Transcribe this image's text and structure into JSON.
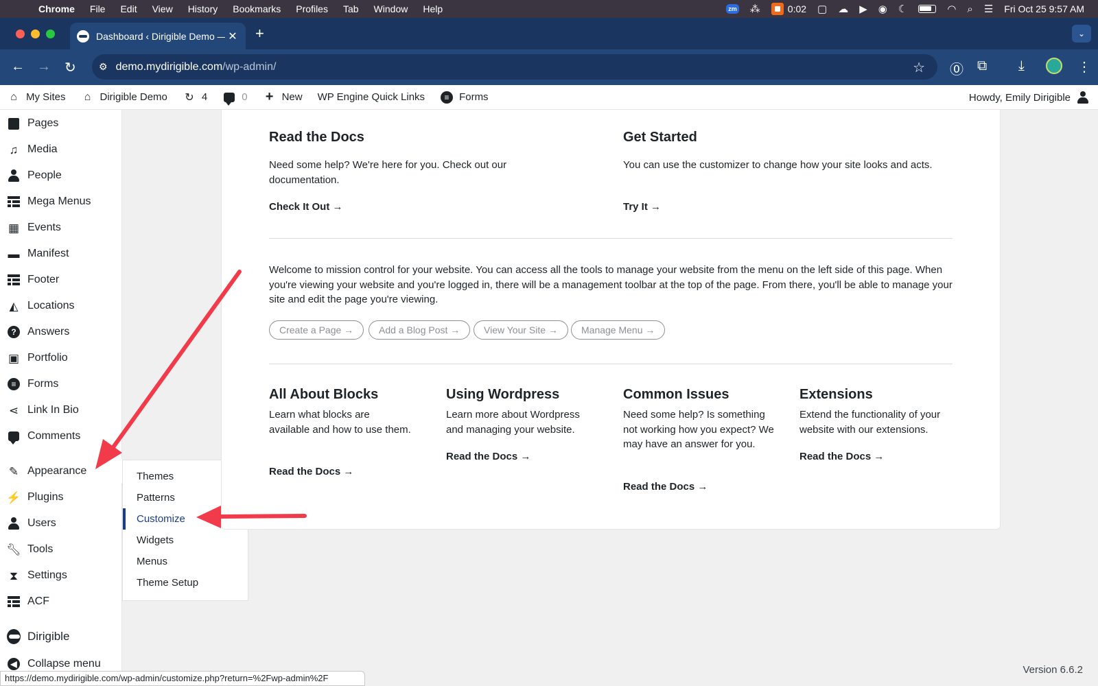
{
  "macos": {
    "app_name": "Chrome",
    "menus": [
      "File",
      "Edit",
      "View",
      "History",
      "Bookmarks",
      "Profiles",
      "Tab",
      "Window",
      "Help"
    ],
    "zoom_badge": "zm",
    "recording_time": "0:02",
    "clock": "Fri Oct 25  9:57 AM"
  },
  "browser": {
    "tab_title": "Dashboard ‹ Dirigible Demo — ",
    "url_host": "demo.mydirigible.com",
    "url_path": "/wp-admin/"
  },
  "admin_bar": {
    "my_sites": "My Sites",
    "site_name": "Dirigible Demo",
    "updates_count": "4",
    "comments_count": "0",
    "new_label": "New",
    "quick_links": "WP Engine Quick Links",
    "forms": "Forms",
    "howdy": "Howdy, Emily Dirigible"
  },
  "sidebar": {
    "items": [
      {
        "label": "Pages",
        "icon": "pages-icon"
      },
      {
        "label": "Media",
        "icon": "media-icon"
      },
      {
        "label": "People",
        "icon": "people-icon"
      },
      {
        "label": "Mega Menus",
        "icon": "grid-icon"
      },
      {
        "label": "Events",
        "icon": "calendar-icon"
      },
      {
        "label": "Manifest",
        "icon": "folder-icon"
      },
      {
        "label": "Footer",
        "icon": "grid-icon"
      },
      {
        "label": "Locations",
        "icon": "map-icon"
      },
      {
        "label": "Answers",
        "icon": "question-icon"
      },
      {
        "label": "Portfolio",
        "icon": "portfolio-icon"
      },
      {
        "label": "Forms",
        "icon": "forms-icon"
      },
      {
        "label": "Link In Bio",
        "icon": "share-icon"
      },
      {
        "label": "Comments",
        "icon": "comment-icon"
      },
      {
        "label": "Appearance",
        "icon": "brush-icon"
      },
      {
        "label": "Plugins",
        "icon": "plugin-icon"
      },
      {
        "label": "Users",
        "icon": "user-icon"
      },
      {
        "label": "Tools",
        "icon": "wrench-icon"
      },
      {
        "label": "Settings",
        "icon": "settings-icon"
      },
      {
        "label": "ACF",
        "icon": "acf-icon"
      }
    ],
    "dirigible": "Dirigible",
    "collapse": "Collapse menu"
  },
  "appearance_submenu": {
    "items": [
      "Themes",
      "Patterns",
      "Customize",
      "Widgets",
      "Menus",
      "Theme Setup"
    ],
    "current": "Customize"
  },
  "dashboard": {
    "read_docs": {
      "title": "Read the Docs",
      "text": "Need some help? We're here for you. Check out our documentation.",
      "cta": "Check It Out →"
    },
    "get_started": {
      "title": "Get Started",
      "text": "You can use the customizer to change how your site looks and acts.",
      "cta": "Try It →"
    },
    "welcome": "Welcome to mission control for your website. You can access all the tools to manage your website from the menu on the left side of this page. When you're viewing your website and you're logged in, there will be a management toolbar at the top of the page. From there, you'll be able to manage your site and edit the page you're viewing.",
    "buttons": [
      "Create a Page →",
      "Add a Blog Post →",
      "View Your Site →",
      "Manage Menu →"
    ],
    "cards": [
      {
        "title": "All About Blocks",
        "text": "Learn what blocks are available and how to use them.",
        "cta": "Read the Docs →"
      },
      {
        "title": "Using Wordpress",
        "text": "Learn more about Wordpress and managing your website.",
        "cta": "Read the Docs →"
      },
      {
        "title": "Common Issues",
        "text": "Need some help? Is something not working how you expect? We may have an answer for you.",
        "cta": "Read the Docs →"
      },
      {
        "title": "Extensions",
        "text": "Extend the functionality of your website with our extensions.",
        "cta": "Read the Docs →"
      }
    ]
  },
  "footer": {
    "version": "Version 6.6.2",
    "status_url": "https://demo.mydirigible.com/wp-admin/customize.php?return=%2Fwp-admin%2F"
  },
  "colors": {
    "browser_frame": "#1a3560",
    "accent": "#1a3c8f",
    "annotation_arrow": "#f23b4a"
  }
}
